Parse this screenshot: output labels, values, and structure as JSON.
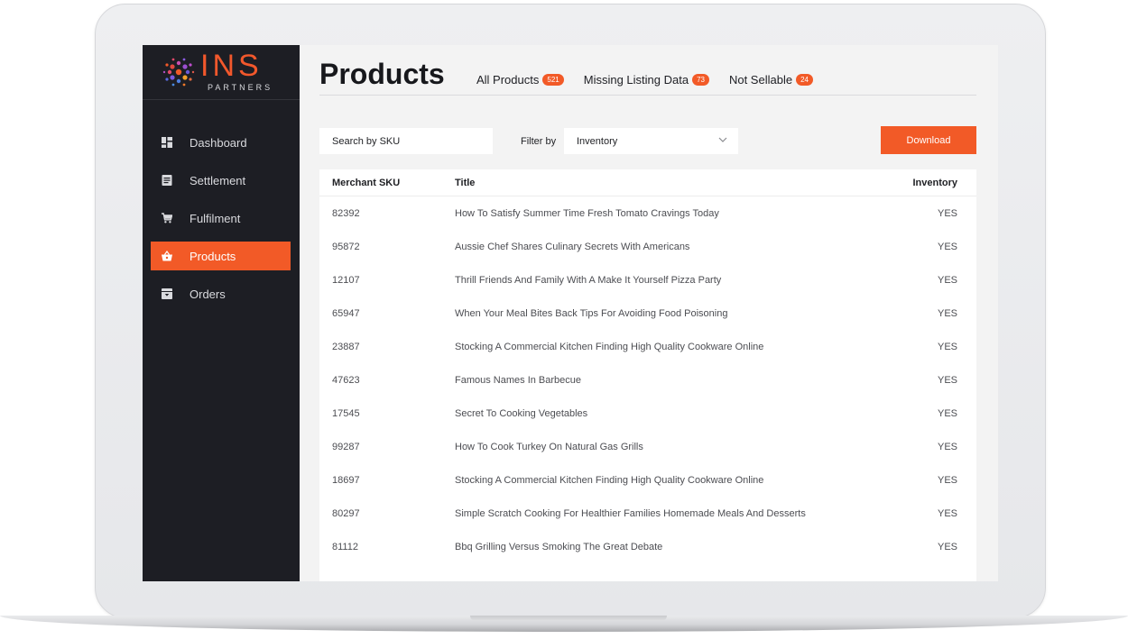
{
  "brand": {
    "name": "INS",
    "subtitle": "PARTNERS"
  },
  "sidebar": {
    "items": [
      {
        "label": "Dashboard",
        "icon": "dashboard-icon",
        "active": false
      },
      {
        "label": "Settlement",
        "icon": "document-icon",
        "active": false
      },
      {
        "label": "Fulfilment",
        "icon": "cart-icon",
        "active": false
      },
      {
        "label": "Products",
        "icon": "basket-icon",
        "active": true
      },
      {
        "label": "Orders",
        "icon": "archive-icon",
        "active": false
      }
    ]
  },
  "header": {
    "title": "Products",
    "tabs": [
      {
        "label": "All Products",
        "count": "521"
      },
      {
        "label": "Missing Listing Data",
        "count": "73"
      },
      {
        "label": "Not Sellable",
        "count": "24"
      }
    ]
  },
  "toolbar": {
    "search_placeholder": "Search by SKU",
    "filter_label": "Filter by",
    "filter_value": "Inventory",
    "download_label": "Download"
  },
  "table": {
    "headers": {
      "sku": "Merchant SKU",
      "title": "Title",
      "inventory": "Inventory"
    },
    "rows": [
      {
        "sku": "82392",
        "title": "How To Satisfy Summer Time Fresh Tomato Cravings Today",
        "inventory": "YES"
      },
      {
        "sku": "95872",
        "title": "Aussie Chef Shares Culinary Secrets With Americans",
        "inventory": "YES"
      },
      {
        "sku": "12107",
        "title": "Thrill Friends And Family With A Make It Yourself Pizza Party",
        "inventory": "YES"
      },
      {
        "sku": "65947",
        "title": "When Your Meal Bites Back Tips For Avoiding Food Poisoning",
        "inventory": "YES"
      },
      {
        "sku": "23887",
        "title": "Stocking A Commercial Kitchen Finding High Quality Cookware Online",
        "inventory": "YES"
      },
      {
        "sku": "47623",
        "title": "Famous Names In Barbecue",
        "inventory": "YES"
      },
      {
        "sku": "17545",
        "title": "Secret To Cooking Vegetables",
        "inventory": "YES"
      },
      {
        "sku": "99287",
        "title": "How To Cook Turkey On Natural Gas Grills",
        "inventory": "YES"
      },
      {
        "sku": "18697",
        "title": "Stocking A Commercial Kitchen Finding High Quality Cookware Online",
        "inventory": "YES"
      },
      {
        "sku": "80297",
        "title": "Simple Scratch Cooking For Healthier Families Homemade Meals And Desserts",
        "inventory": "YES"
      },
      {
        "sku": "81112",
        "title": "Bbq Grilling Versus Smoking The Great Debate",
        "inventory": "YES"
      }
    ]
  },
  "colors": {
    "accent": "#f25a27",
    "sidebar": "#1d1e24"
  }
}
